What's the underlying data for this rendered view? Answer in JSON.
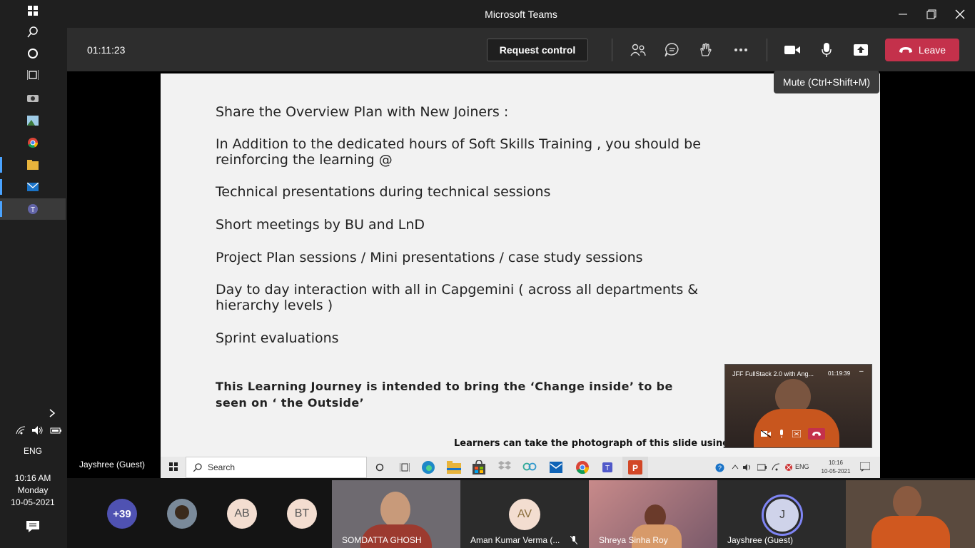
{
  "app": {
    "title": "Microsoft Teams"
  },
  "meeting": {
    "timer": "01:11:23",
    "request_control_label": "Request control",
    "leave_label": "Leave",
    "mute_tooltip": "Mute (Ctrl+Shift+M)",
    "presenter_name": "Jayshree (Guest)"
  },
  "slide": {
    "lines": [
      "Share the Overview Plan with New Joiners :",
      "In Addition to the dedicated hours of Soft Skills Training , you should be reinforcing the learning @",
      "Technical presentations during technical sessions",
      "Short meetings by BU and LnD",
      "Project Plan sessions / Mini presentations / case study sessions",
      "Day to day interaction with all in Capgemini ( across all departments & hierarchy levels )",
      "Sprint evaluations"
    ],
    "bold_note": "This Learning Journey is intended to bring the ‘Change inside’ to be seen on ‘ the Outside’",
    "footer_note": "Learners can take the photograph of this slide using t"
  },
  "pip": {
    "title": "JFF FullStack 2.0 with Ang...",
    "time": "01:19:39"
  },
  "shared_taskbar": {
    "search_placeholder": "Search",
    "lang": "ENG",
    "time": "10:16",
    "date": "10-05-2021"
  },
  "participants": {
    "overflow": "+39",
    "avatars": [
      "AB",
      "BT",
      "AV",
      "J"
    ],
    "tiles": [
      "SOMDATTA GHOSH",
      "Aman Kumar Verma (...",
      "Shreya Sinha Roy",
      "Jayshree (Guest)"
    ]
  },
  "system": {
    "lang": "ENG",
    "time": "10:16 AM",
    "day": "Monday",
    "date": "10-05-2021"
  },
  "colors": {
    "leave": "#c4314b",
    "accent": "#6264a7",
    "avatar_bg": "#f3ddd0"
  }
}
